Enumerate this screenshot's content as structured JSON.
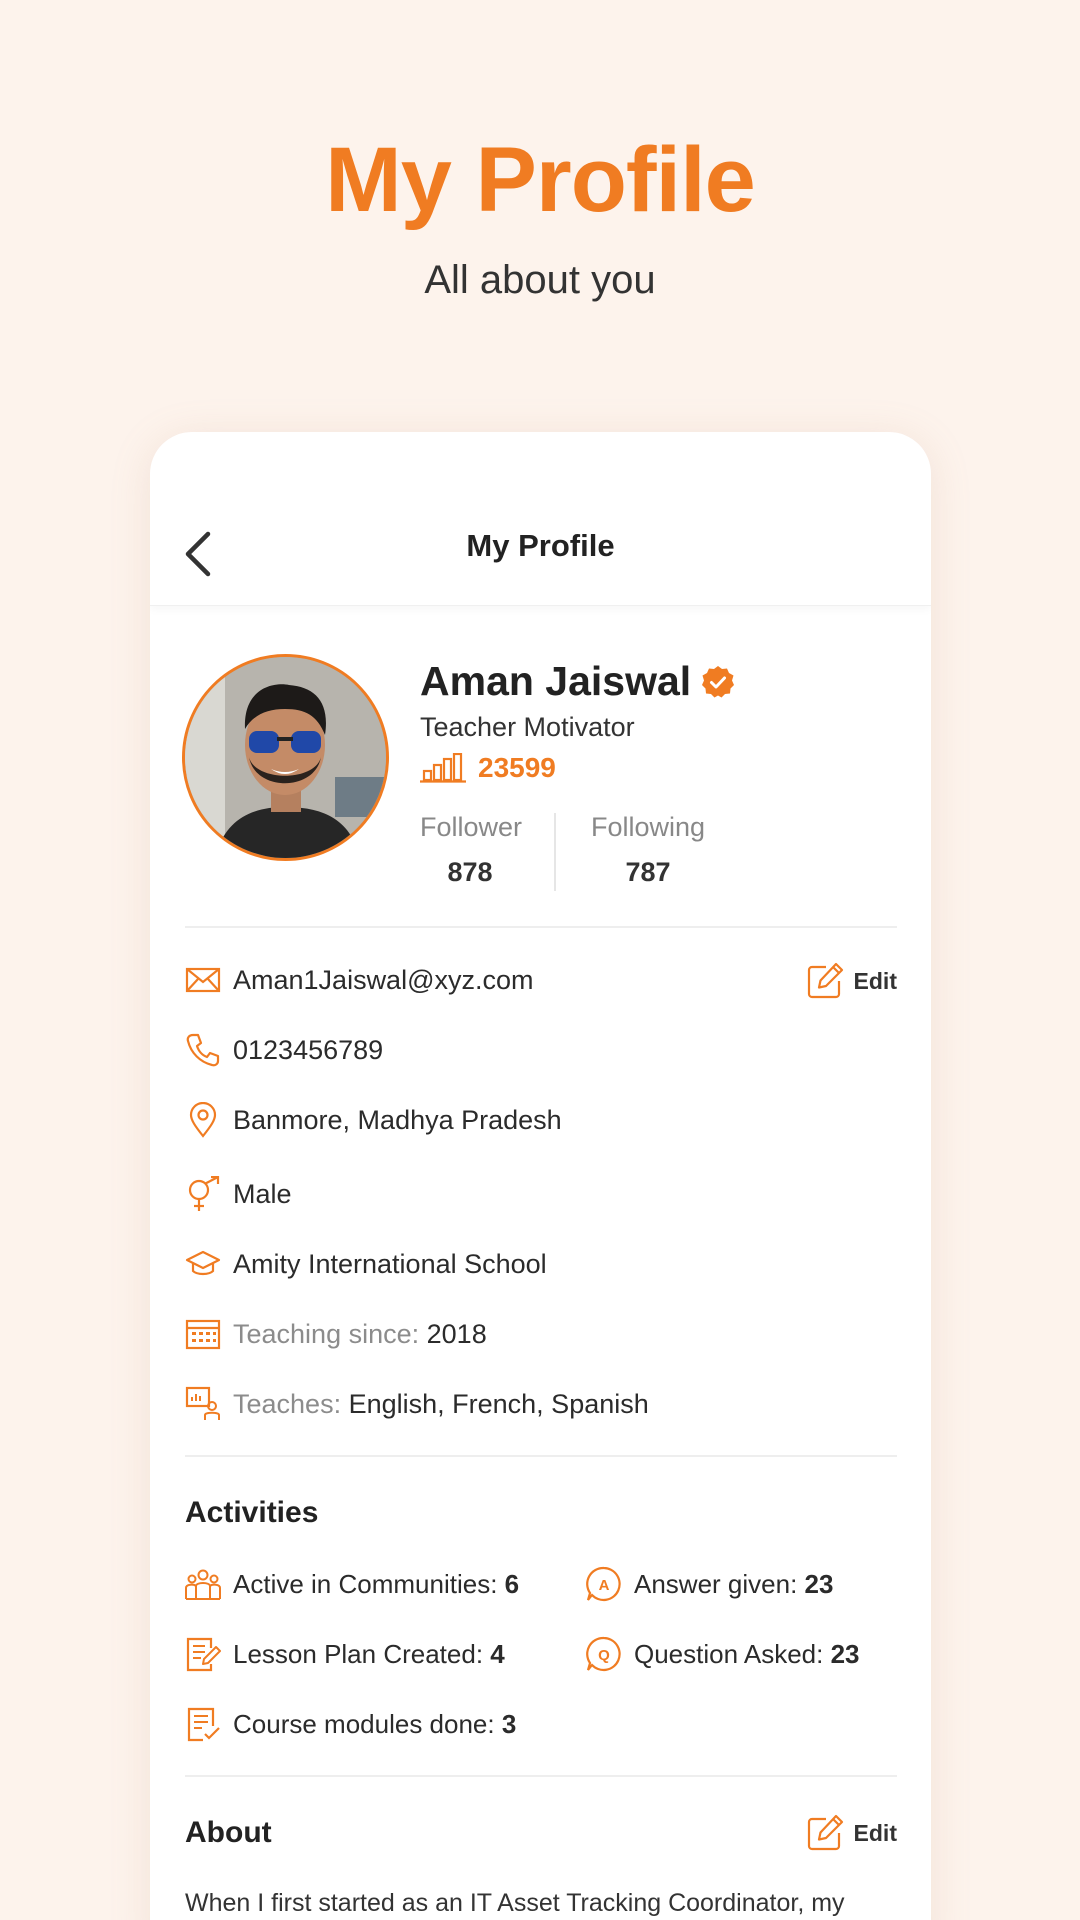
{
  "hero": {
    "title": "My Profile",
    "subtitle": "All about you"
  },
  "appbar": {
    "title": "My Profile"
  },
  "profile": {
    "name": "Aman Jaiswal",
    "role": "Teacher Motivator",
    "points": "23599",
    "follower_label": "Follower",
    "follower_count": "878",
    "following_label": "Following",
    "following_count": "787"
  },
  "contact": {
    "email": "Aman1Jaiswal@xyz.com",
    "phone": "0123456789",
    "location": "Banmore, Madhya Pradesh",
    "gender": "Male",
    "school": "Amity International School",
    "teaching_since_label": "Teaching since:",
    "teaching_since_value": "2018",
    "teaches_label": "Teaches:",
    "teaches_value": "English, French, Spanish",
    "edit_label": "Edit"
  },
  "activities": {
    "title": "Activities",
    "items": [
      {
        "label": "Active in Communities:",
        "value": "6",
        "icon": "community-icon"
      },
      {
        "label": "Answer given:",
        "value": "23",
        "icon": "answer-icon"
      },
      {
        "label": "Lesson Plan Created:",
        "value": "4",
        "icon": "lesson-plan-icon"
      },
      {
        "label": "Question Asked:",
        "value": "23",
        "icon": "question-icon"
      },
      {
        "label": "Course modules done:",
        "value": "3",
        "icon": "course-icon"
      }
    ]
  },
  "about": {
    "title": "About",
    "edit_label": "Edit",
    "text": "When I first started as an IT Asset Tracking Coordinator, my"
  },
  "colors": {
    "accent": "#f07c22",
    "background": "#fdf3ec"
  }
}
